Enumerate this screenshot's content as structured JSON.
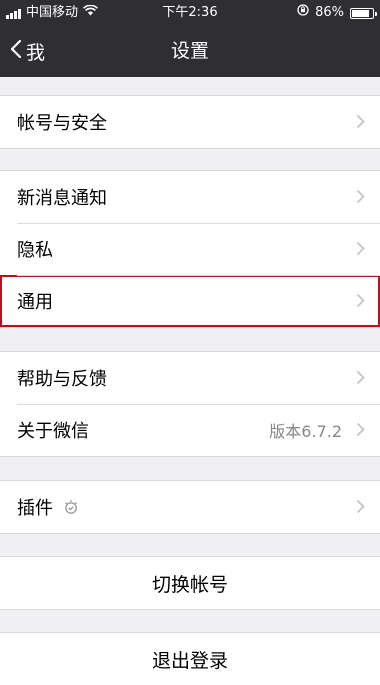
{
  "status_bar": {
    "carrier": "中国移动",
    "time": "下午2:36",
    "battery": "86%",
    "battery_level": 0.86,
    "icons": [
      "signal-icon",
      "wifi-icon",
      "rotation-lock-icon",
      "battery-icon"
    ]
  },
  "nav": {
    "back_label": "我",
    "title": "设置"
  },
  "groups": {
    "account": {
      "label": "帐号与安全"
    },
    "privacy": [
      {
        "label": "新消息通知"
      },
      {
        "label": "隐私"
      },
      {
        "label": "通用"
      }
    ],
    "about": [
      {
        "label": "帮助与反馈"
      },
      {
        "label": "关于微信",
        "value": "版本6.7.2"
      }
    ],
    "plugins": {
      "label": "插件"
    },
    "switch_account": {
      "label": "切换帐号"
    },
    "logout": {
      "label": "退出登录"
    }
  },
  "colors": {
    "nav_background": "#2e2e33",
    "page_background": "#efeff4",
    "highlight_border": "#b3141b"
  }
}
